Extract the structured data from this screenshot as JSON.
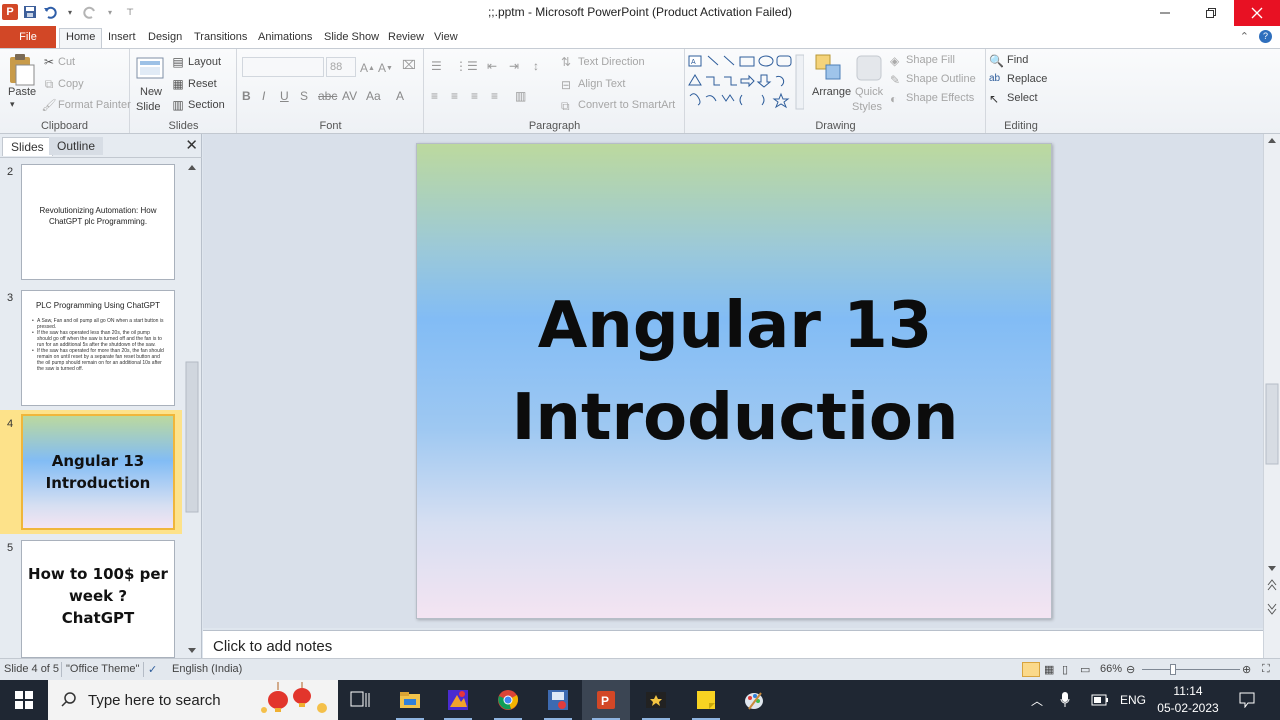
{
  "titlebar": {
    "title": ";;.pptm - Microsoft PowerPoint (Product Activation Failed)",
    "app_icon": "P"
  },
  "ribbon_tabs": [
    "File",
    "Home",
    "Insert",
    "Design",
    "Transitions",
    "Animations",
    "Slide Show",
    "Review",
    "View"
  ],
  "ribbon": {
    "clipboard": {
      "paste": "Paste",
      "cut": "Cut",
      "copy": "Copy",
      "format_painter": "Format Painter",
      "label": "Clipboard"
    },
    "slides": {
      "new_slide_line1": "New",
      "new_slide_line2": "Slide",
      "layout": "Layout",
      "reset": "Reset",
      "section": "Section",
      "label": "Slides"
    },
    "font": {
      "size": "88",
      "label": "Font"
    },
    "paragraph": {
      "text_direction": "Text Direction",
      "align_text": "Align Text",
      "convert_smartart": "Convert to SmartArt",
      "label": "Paragraph"
    },
    "drawing": {
      "arrange": "Arrange",
      "quick_styles_line1": "Quick",
      "quick_styles_line2": "Styles",
      "shape_fill": "Shape Fill",
      "shape_outline": "Shape Outline",
      "shape_effects": "Shape Effects",
      "label": "Drawing"
    },
    "editing": {
      "find": "Find",
      "replace": "Replace",
      "select": "Select",
      "label": "Editing"
    }
  },
  "panel": {
    "tab_slides": "Slides",
    "tab_outline": "Outline",
    "slides": [
      {
        "num": "2",
        "text": "Revolutionizing Automation: How ChatGPT  plc Programming."
      },
      {
        "num": "3",
        "title": "PLC Programming  Using ChatGPT",
        "bullets": [
          "A Saw, Fan and oil pump all go ON when a start button is pressed.",
          "If the saw has operated less than 20s, the oil pump should go off when the saw is turned off and the fan is to run for an additional 5s after the shutdown of the saw.",
          "If the saw has operated for more than 20s, the fan should remain on until reset by a separate fan reset button and the oil pump should remain on for an additional 10s after the saw is turned off."
        ]
      },
      {
        "num": "4",
        "line1": "Angular 13",
        "line2": "Introduction"
      },
      {
        "num": "5",
        "line1": "How to 100$ per",
        "line2": "week ?",
        "line3": "ChatGPT"
      }
    ]
  },
  "slide": {
    "title_line1": "Angular 13",
    "title_line2": "Introduction"
  },
  "notes": {
    "placeholder": "Click to add notes"
  },
  "status": {
    "slide_info": "Slide 4 of 5",
    "theme": "\"Office Theme\"",
    "language": "English (India)",
    "zoom": "66%"
  },
  "taskbar": {
    "search_placeholder": "Type here to search",
    "lang": "ENG",
    "time": "11:14",
    "date": "05-02-2023"
  },
  "colors": {
    "file_tab": "#d24726",
    "close_button": "#e81123",
    "selected_thumb": "#fde28a"
  }
}
